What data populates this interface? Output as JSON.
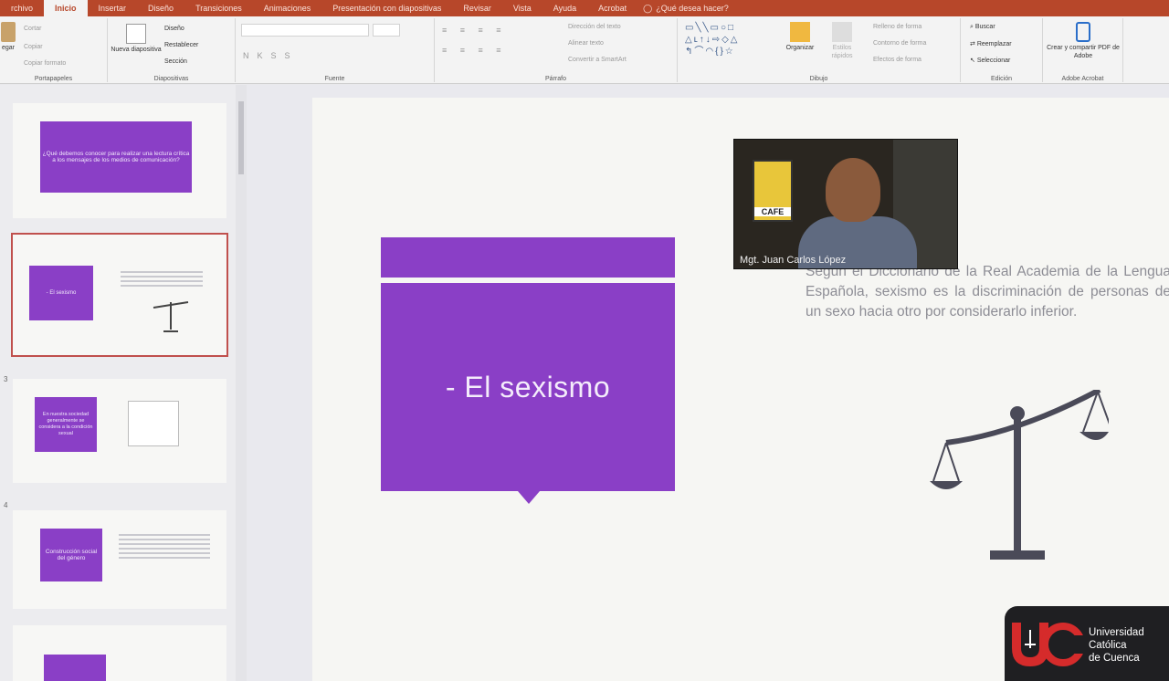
{
  "ribbon_tabs": [
    "rchivo",
    "Inicio",
    "Insertar",
    "Diseño",
    "Transiciones",
    "Animaciones",
    "Presentación con diapositivas",
    "Revisar",
    "Vista",
    "Ayuda",
    "Acrobat"
  ],
  "active_tab": "Inicio",
  "tell_me": "¿Qué desea hacer?",
  "groups": {
    "portapapeles": {
      "label": "Portapapeles",
      "paste": "egar",
      "cut": "Cortar",
      "copy": "Copiar",
      "format": "Copiar formato"
    },
    "diapositivas": {
      "label": "Diapositivas",
      "new_slide": "Nueva diapositiva",
      "layout": "Diseño",
      "reset": "Restablecer",
      "section": "Sección"
    },
    "fuente": {
      "label": "Fuente"
    },
    "parrafo": {
      "label": "Párrafo",
      "text_dir": "Dirección del texto",
      "align": "Alinear texto",
      "smartart": "Convertir a SmartArt"
    },
    "dibujo": {
      "label": "Dibujo",
      "arrange": "Organizar",
      "styles": "Estilos rápidos",
      "fill": "Relleno de forma",
      "outline": "Contorno de forma",
      "effects": "Efectos de forma"
    },
    "edicion": {
      "label": "Edición",
      "find": "Buscar",
      "replace": "Reemplazar",
      "select": "Seleccionar"
    },
    "adobe": {
      "label": "Adobe Acrobat",
      "create": "Crear y compartir PDF de Adobe"
    }
  },
  "thumbnails": [
    {
      "num": "",
      "title": "¿Qué debemos conocer para realizar una lectura crítica a los mensajes de los medios de comunicación?"
    },
    {
      "num": "",
      "title": "- El sexismo"
    },
    {
      "num": "3",
      "title": "En nuestra sociedad generalmente se considera a la condición sexual"
    },
    {
      "num": "4",
      "title": "Construcción social del género"
    }
  ],
  "slide": {
    "title": "- El sexismo",
    "definition": "Según el Diccionario de la Real Academia de la Lengua Española, sexismo es la discriminación de personas de un sexo hacia otro por considerarlo inferior."
  },
  "video": {
    "name": "Mgt. Juan Carlos López",
    "sign": "CAFE"
  },
  "logo": {
    "line1": "Universidad",
    "line2": "Católica",
    "line3": "de Cuenca"
  },
  "colors": {
    "purple": "#8a3fc6",
    "ribbon_red": "#b7472a",
    "logo_red": "#d52b2b"
  }
}
